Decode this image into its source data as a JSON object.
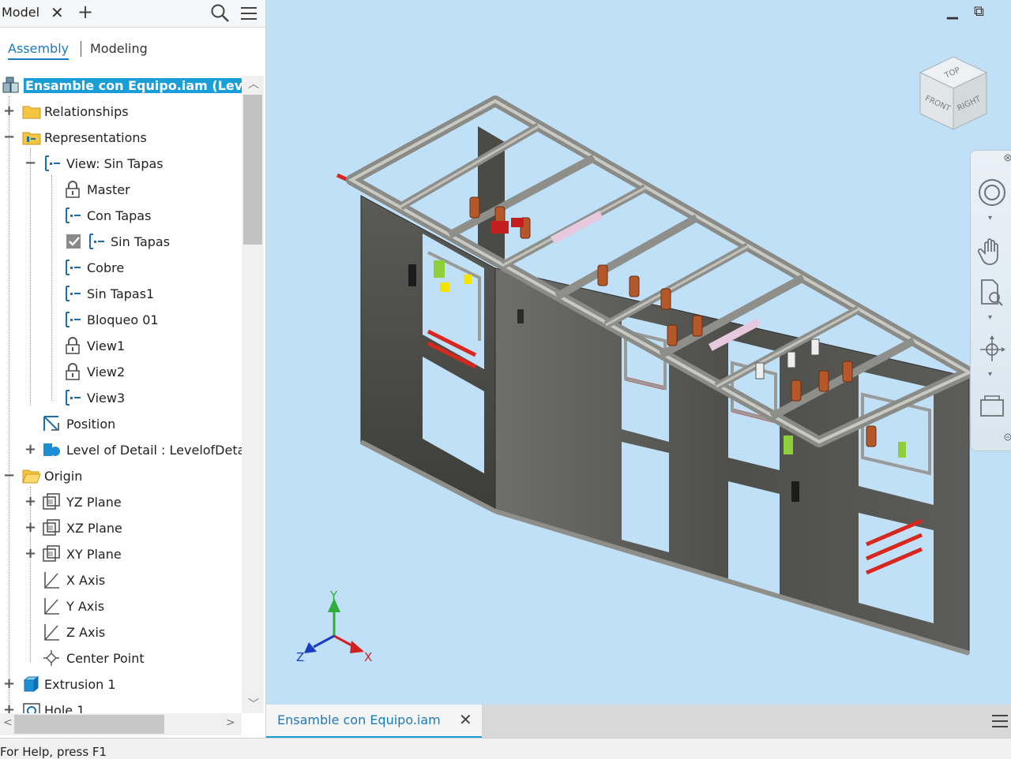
{
  "panel": {
    "title": "Model",
    "close_glyph": "✕",
    "add_glyph": "+",
    "icons": {
      "search": "search-icon",
      "menu": "hamburger-menu-icon"
    }
  },
  "tabs": {
    "assembly": "Assembly",
    "modeling": "Modeling"
  },
  "tree": [
    {
      "label": "Ensamble con Equipo.iam (Lev",
      "icon": "assembly-icon",
      "selected": true
    },
    {
      "label": "Relationships",
      "icon": "folder-icon",
      "expander": "+"
    },
    {
      "label": "Representations",
      "icon": "representations-folder-icon",
      "expander": "−"
    },
    {
      "label": "View: Sin Tapas",
      "icon": "view-rep-icon",
      "expander": "−"
    },
    {
      "label": "Master",
      "icon": "lock-icon"
    },
    {
      "label": "Con Tapas",
      "icon": "view-rep-icon"
    },
    {
      "label": "Sin Tapas",
      "icon": "view-rep-icon",
      "checked": true
    },
    {
      "label": "Cobre",
      "icon": "view-rep-icon"
    },
    {
      "label": "Sin Tapas1",
      "icon": "view-rep-icon"
    },
    {
      "label": "Bloqueo 01",
      "icon": "view-rep-icon"
    },
    {
      "label": "View1",
      "icon": "lock-icon"
    },
    {
      "label": "View2",
      "icon": "lock-icon"
    },
    {
      "label": "View3",
      "icon": "view-rep-icon"
    },
    {
      "label": "Position",
      "icon": "position-icon"
    },
    {
      "label": "Level of Detail : LevelofDeta",
      "icon": "level-of-detail-icon",
      "expander": "+"
    },
    {
      "label": "Origin",
      "icon": "folder-open-icon",
      "expander": "−"
    },
    {
      "label": "YZ Plane",
      "icon": "plane-icon",
      "expander": "+"
    },
    {
      "label": "XZ Plane",
      "icon": "plane-icon",
      "expander": "+"
    },
    {
      "label": "XY Plane",
      "icon": "plane-icon",
      "expander": "+"
    },
    {
      "label": "X Axis",
      "icon": "axis-icon"
    },
    {
      "label": "Y Axis",
      "icon": "axis-icon"
    },
    {
      "label": "Z Axis",
      "icon": "axis-icon"
    },
    {
      "label": "Center Point",
      "icon": "point-icon"
    },
    {
      "label": "Extrusion 1",
      "icon": "extrusion-icon",
      "expander": "+"
    },
    {
      "label": "Hole 1",
      "icon": "hole-icon",
      "expander": "+"
    }
  ],
  "viewcube": {
    "top": "TOP",
    "front": "FRONT",
    "right": "RIGHT"
  },
  "triad": {
    "x": "X",
    "y": "Y",
    "z": "Z"
  },
  "window": {
    "minimize": "▁",
    "restore": "⧉"
  },
  "document_tab": {
    "label": "Ensamble con Equipo.iam",
    "close_glyph": "✕"
  },
  "status": {
    "text": "For Help, press F1"
  },
  "colors": {
    "accent": "#1a9ed9",
    "viewport_bg": "#bfe0f6",
    "frame": "#5a5a58",
    "copper": "#b4582a",
    "busbar_red": "#d8281e"
  }
}
